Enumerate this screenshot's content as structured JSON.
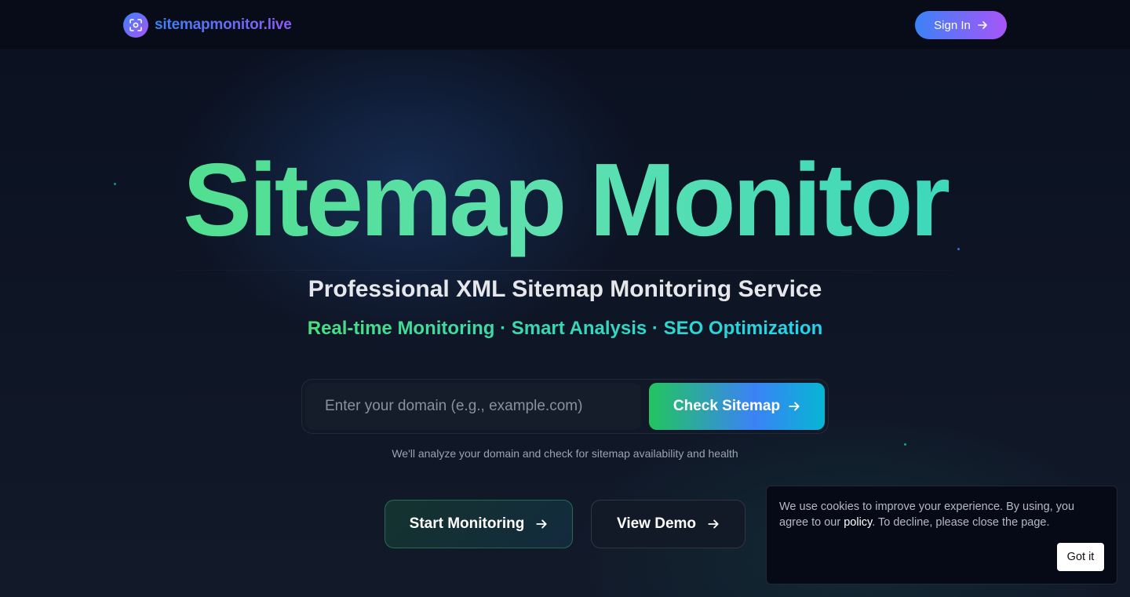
{
  "header": {
    "brand": "sitemapmonitor.live",
    "logo_icon": "focus-camera-icon",
    "signin_label": "Sign In",
    "signin_icon": "arrow-right-icon"
  },
  "hero": {
    "title": "Sitemap Monitor",
    "subtitle": "Professional XML Sitemap Monitoring Service",
    "features": "Real-time Monitoring · Smart Analysis · SEO Optimization"
  },
  "search": {
    "placeholder": "Enter your domain (e.g., example.com)",
    "value": "",
    "button_label": "Check Sitemap",
    "button_icon": "arrow-right-icon",
    "helper": "We'll analyze your domain and check for sitemap availability and health"
  },
  "cta": {
    "start_label": "Start Monitoring",
    "demo_label": "View Demo"
  },
  "cookie": {
    "text_before": "We use cookies to improve your experience. By using, you agree to our ",
    "link_label": "policy",
    "text_after": ". To decline, please close the page.",
    "accept_label": "Got it"
  },
  "colors": {
    "accent_blue": "#3b82f6",
    "accent_purple": "#a855f7",
    "accent_green": "#4ade80",
    "accent_teal": "#2dd4bf",
    "background": "#0b1120"
  }
}
